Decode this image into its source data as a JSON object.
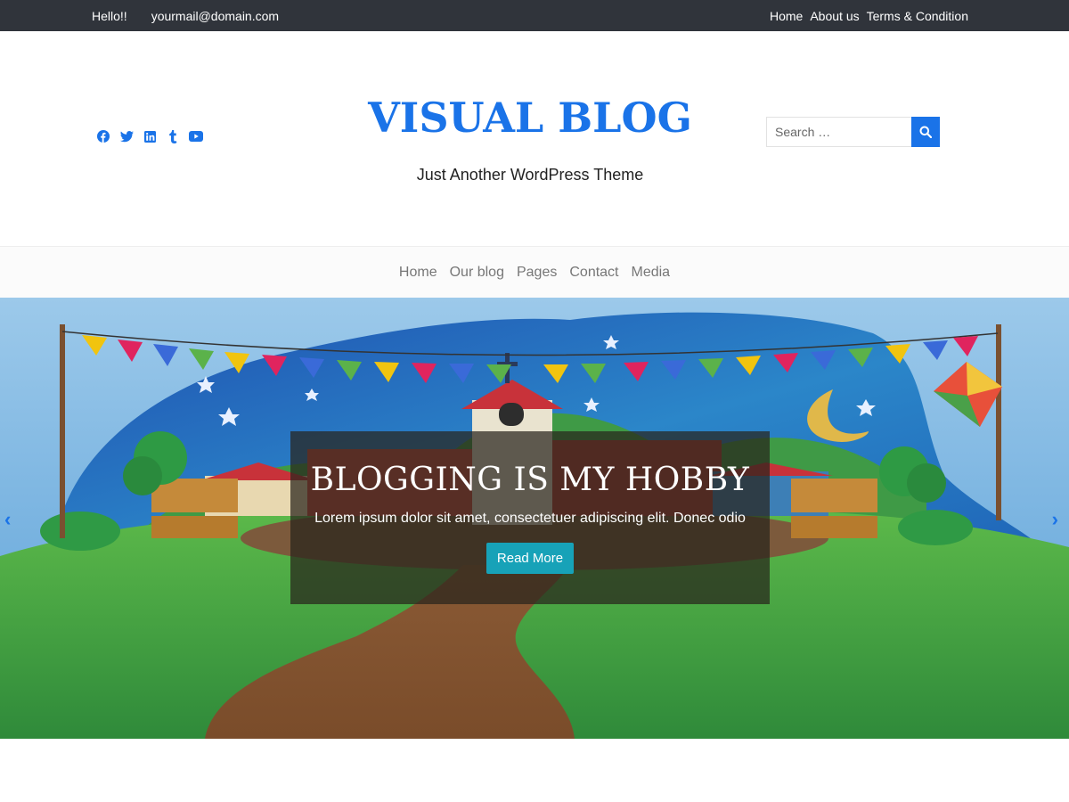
{
  "topbar": {
    "greeting": "Hello!!",
    "email": "yourmail@domain.com",
    "links": [
      "Home",
      "About us",
      "Terms & Condition"
    ]
  },
  "header": {
    "social_icons": [
      "facebook-icon",
      "twitter-icon",
      "linkedin-icon",
      "tumblr-icon",
      "youtube-icon"
    ],
    "site_title": "VISUAL BLOG",
    "tagline": "Just Another WordPress Theme",
    "search": {
      "placeholder": "Search …"
    }
  },
  "nav": {
    "items": [
      "Home",
      "Our blog",
      "Pages",
      "Contact",
      "Media"
    ]
  },
  "hero": {
    "title": "BLOGGING IS MY HOBBY",
    "text": "Lorem ipsum dolor sit amet, consectetuer adipiscing elit. Donec odio",
    "button": "Read More",
    "prev": "‹",
    "next": "›"
  },
  "colors": {
    "accent": "#1a73e8",
    "topbar": "#30343b",
    "button": "#17a2b8"
  }
}
